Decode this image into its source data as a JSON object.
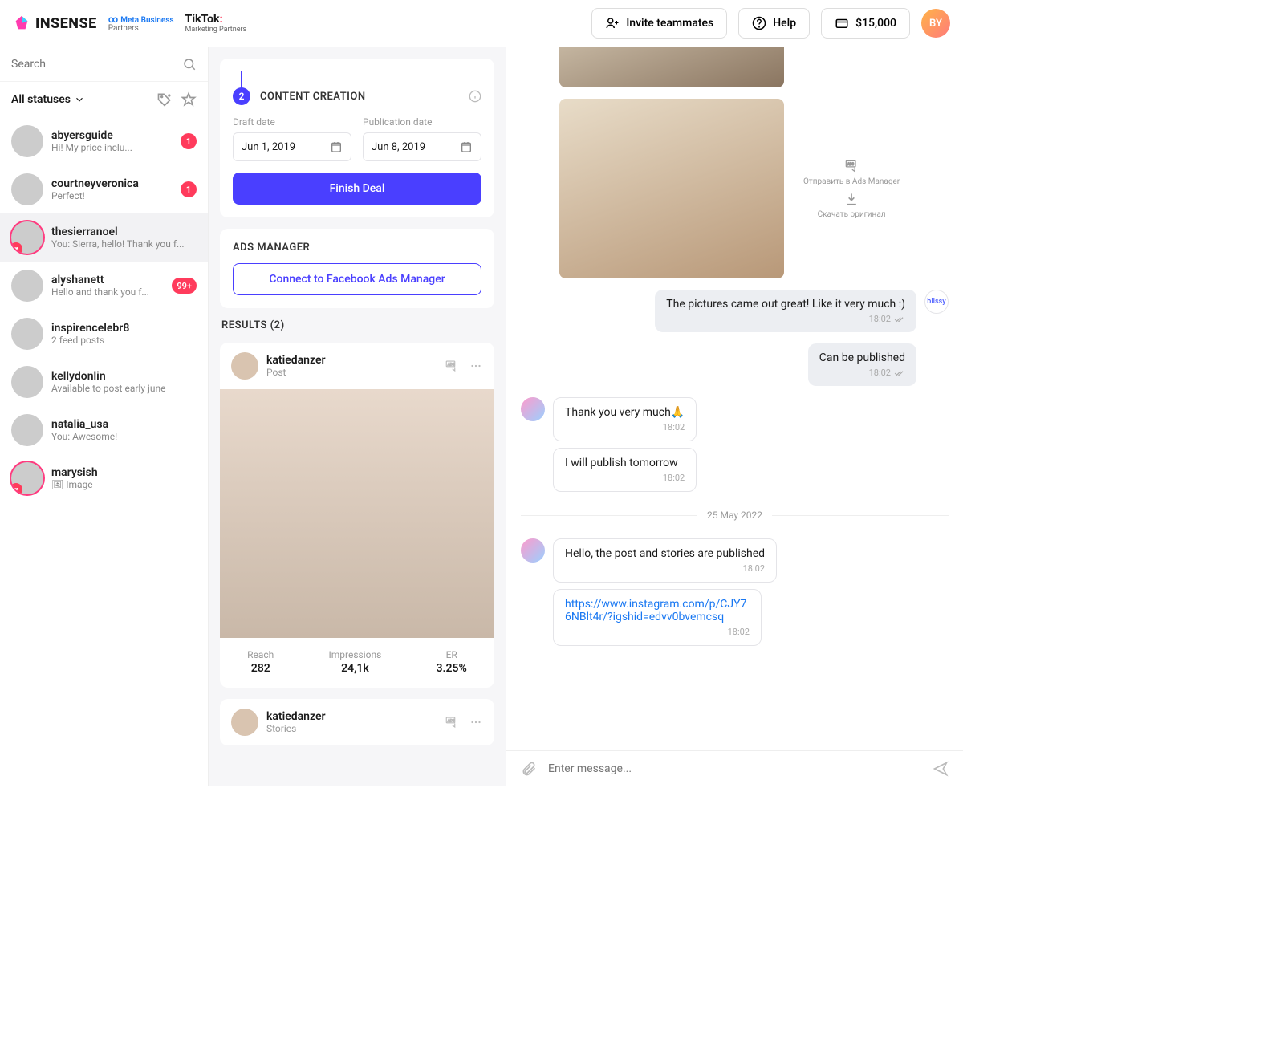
{
  "topbar": {
    "brand": "INSENSE",
    "meta_l1": "Meta Business",
    "meta_l2": "Partners",
    "tiktok": "TikTok",
    "tiktok_sub": "Marketing Partners",
    "invite": "Invite teammates",
    "help": "Help",
    "balance": "$15,000",
    "avatar_initials": "BY"
  },
  "sidebar": {
    "search_placeholder": "Search",
    "filter_label": "All statuses",
    "conversations": [
      {
        "name": "abyersguide",
        "preview": "Hi! My price inclu...",
        "badge": "1",
        "heart": false,
        "ring": false
      },
      {
        "name": "courtneyveronica",
        "preview": "Perfect!",
        "badge": "1",
        "heart": false,
        "ring": false
      },
      {
        "name": "thesierranoel",
        "preview": "You: Sierra, hello! Thank you f...",
        "badge": "",
        "heart": true,
        "ring": true,
        "active": true
      },
      {
        "name": "alyshanett",
        "preview": "Hello and thank you f...",
        "badge": "99+",
        "heart": false,
        "ring": false
      },
      {
        "name": "inspirencelebr8",
        "preview": "2 feed posts",
        "badge": "",
        "heart": false,
        "ring": false
      },
      {
        "name": "kellydonlin",
        "preview": "Available to post early june",
        "badge": "",
        "heart": false,
        "ring": false
      },
      {
        "name": "natalia_usa",
        "preview": "You: Awesome!",
        "badge": "",
        "heart": false,
        "ring": false
      },
      {
        "name": "marysish",
        "preview": "Image",
        "badge": "",
        "heart": true,
        "ring": true,
        "icon": true
      }
    ]
  },
  "mid": {
    "step_num": "2",
    "step_title": "CONTENT CREATION",
    "draft_label": "Draft date",
    "draft_value": "Jun 1, 2019",
    "pub_label": "Publication date",
    "pub_value": "Jun 8, 2019",
    "finish": "Finish Deal",
    "ads_title": "ADS MANAGER",
    "ads_connect": "Connect to Facebook Ads Manager",
    "results_title": "RESULTS (2)",
    "results": [
      {
        "name": "katiedanzer",
        "type": "Post",
        "stats": [
          {
            "lbl": "Reach",
            "val": "282"
          },
          {
            "lbl": "Impressions",
            "val": "24,1k"
          },
          {
            "lbl": "ER",
            "val": "3.25%"
          }
        ]
      },
      {
        "name": "katiedanzer",
        "type": "Stories"
      }
    ]
  },
  "chat": {
    "send_ads": "Отправить в Ads Manager",
    "download": "Скачать оригинал",
    "out1": "The pictures came out great! Like it very much :)",
    "out2": "Can be published",
    "in1": "Thank you very much🙏",
    "in2": "I will publish tomorrow",
    "date_sep": "25 May 2022",
    "in3": "Hello, the post and stories are published",
    "in4": "https://www.instagram.com/p/CJY76NBlt4r/?igshid=edvv0bvemcsq",
    "ts": "18:02",
    "brand": "blissy",
    "composer_placeholder": "Enter message..."
  }
}
